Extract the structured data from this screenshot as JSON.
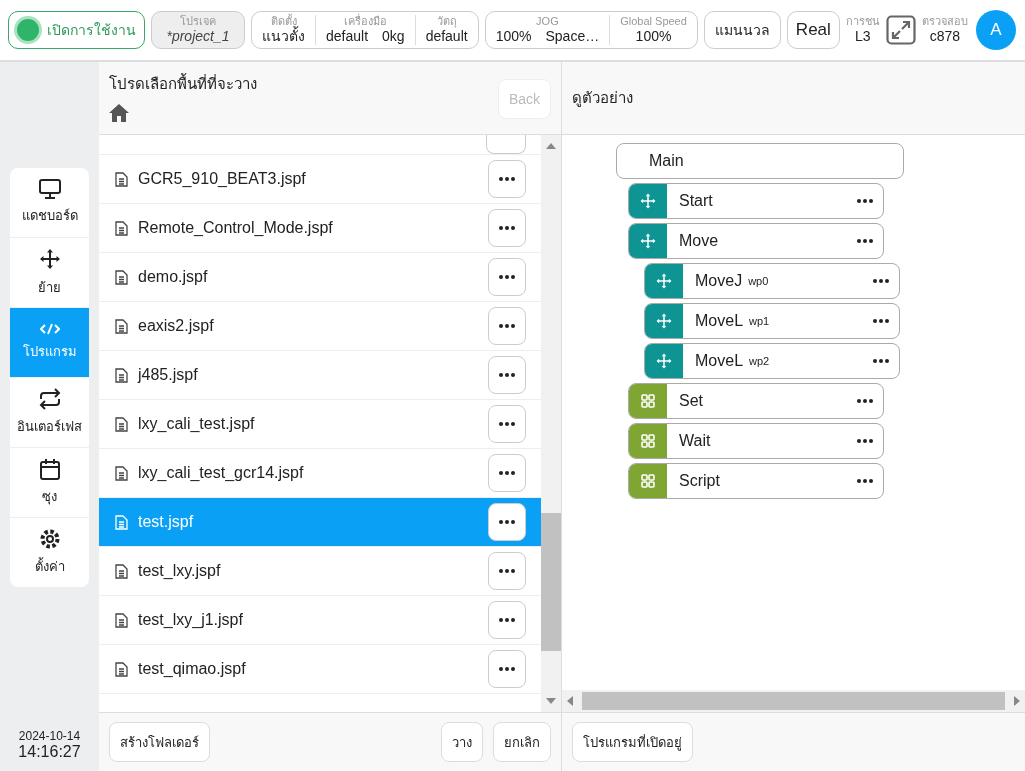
{
  "top_bar": {
    "status": {
      "label": "เปิดการใช้งาน",
      "on": true
    },
    "project": {
      "label": "โปรเจค",
      "value": "*project_1"
    },
    "setup_group": [
      {
        "label": "ติดตั้ง",
        "values": [
          "แนวตั้ง"
        ]
      },
      {
        "label": "เครื่องมือ",
        "values": [
          "default",
          "0kg"
        ]
      },
      {
        "label": "วัตถุ",
        "values": [
          "default"
        ]
      }
    ],
    "speed_group": [
      {
        "label": "JOG",
        "values": [
          "100%",
          "Space…"
        ]
      },
      {
        "label": "Global Speed",
        "values": [
          "100%"
        ]
      }
    ],
    "mode_buttons": [
      "แมนนวล",
      "Real"
    ],
    "collision": {
      "label": "การชน",
      "value": "L3"
    },
    "check": {
      "label": "ตรวจสอบ",
      "value": "c878"
    },
    "avatar": "A"
  },
  "sidebar": {
    "items": [
      {
        "label": "แดชบอร์ด",
        "kind": "monitor",
        "selected": false
      },
      {
        "label": "ย้าย",
        "kind": "move",
        "selected": false
      },
      {
        "label": "โปรแกรม",
        "kind": "code",
        "selected": true
      },
      {
        "label": "อินเตอร์เฟส",
        "kind": "swap",
        "selected": false
      },
      {
        "label": "ซุง",
        "kind": "calendar",
        "selected": false
      },
      {
        "label": "ตั้งค่า",
        "kind": "gear",
        "selected": false
      }
    ],
    "date": "2024-10-14",
    "time": "14:16:27"
  },
  "file_panel": {
    "title": "โปรดเลือกพื้นที่ที่จะวาง",
    "back_button": {
      "label": "Back",
      "disabled": true
    },
    "files": [
      {
        "name": "GCR5_910_BEAT3.jspf",
        "selected": false
      },
      {
        "name": "Remote_Control_Mode.jspf",
        "selected": false
      },
      {
        "name": "demo.jspf",
        "selected": false
      },
      {
        "name": "eaxis2.jspf",
        "selected": false
      },
      {
        "name": "j485.jspf",
        "selected": false
      },
      {
        "name": "lxy_cali_test.jspf",
        "selected": false
      },
      {
        "name": "lxy_cali_test_gcr14.jspf",
        "selected": false
      },
      {
        "name": "test.jspf",
        "selected": true
      },
      {
        "name": "test_lxy.jspf",
        "selected": false
      },
      {
        "name": "test_lxy_j1.jspf",
        "selected": false
      },
      {
        "name": "test_qimao.jspf",
        "selected": false
      }
    ],
    "footer_buttons": [
      "สร้างโฟลเดอร์",
      "วาง",
      "ยกเลิก"
    ]
  },
  "preview_panel": {
    "title": "ดูตัวอย่าง",
    "tree": {
      "label": "Main",
      "children": [
        {
          "label": "Start",
          "kind": "move"
        },
        {
          "label": "Move",
          "kind": "move",
          "children": [
            {
              "label": "MoveJ",
              "waypoint": "wp0",
              "kind": "move"
            },
            {
              "label": "MoveL",
              "waypoint": "wp1",
              "kind": "move"
            },
            {
              "label": "MoveL",
              "waypoint": "wp2",
              "kind": "move"
            }
          ]
        },
        {
          "label": "Set",
          "kind": "grid"
        },
        {
          "label": "Wait",
          "kind": "grid"
        },
        {
          "label": "Script",
          "kind": "grid"
        }
      ]
    },
    "footer_button": "โปรแกรมที่เปิดอยู่"
  }
}
